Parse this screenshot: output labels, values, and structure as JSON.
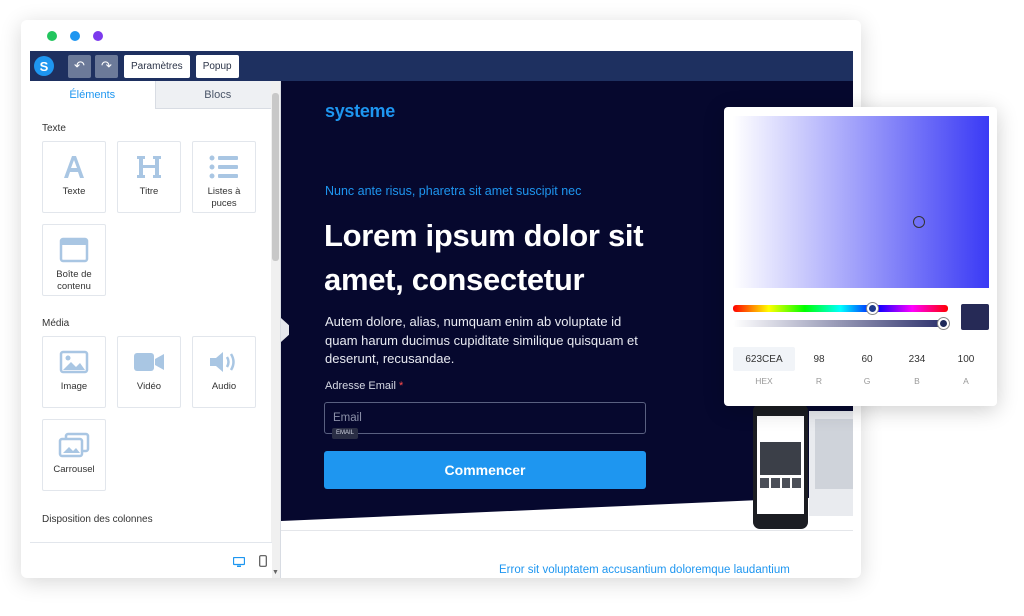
{
  "window": {
    "traffic_lights": [
      "#22c55e",
      "#1e96f0",
      "#7c3aed"
    ]
  },
  "toolbar": {
    "logo_letter": "S",
    "undo_icon": "undo-icon",
    "redo_icon": "redo-icon",
    "settings_label": "Paramètres",
    "popup_label": "Popup"
  },
  "sidebar": {
    "tabs": [
      {
        "label": "Éléments",
        "active": true
      },
      {
        "label": "Blocs",
        "active": false
      }
    ],
    "sections": {
      "texte": "Texte",
      "media": "Média",
      "columns": "Disposition des colonnes"
    },
    "text_items": [
      {
        "label": "Texte",
        "icon": "text-a-icon"
      },
      {
        "label": "Titre",
        "icon": "heading-h-icon"
      },
      {
        "label": "Listes à puces",
        "icon": "bullet-list-icon"
      },
      {
        "label": "Boîte de contenu",
        "icon": "content-box-icon"
      }
    ],
    "media_items": [
      {
        "label": "Image",
        "icon": "image-icon"
      },
      {
        "label": "Vidéo",
        "icon": "video-camera-icon"
      },
      {
        "label": "Audio",
        "icon": "speaker-icon"
      },
      {
        "label": "Carrousel",
        "icon": "carousel-icon"
      }
    ],
    "view_icons": [
      "desktop-icon",
      "mobile-icon"
    ]
  },
  "canvas": {
    "brand": "systeme",
    "eyebrow": "Nunc ante risus, pharetra sit amet suscipit nec",
    "headline": "Lorem ipsum dolor sit amet, consectetur",
    "paragraph": "Autem dolore, alias, numquam enim ab voluptate id quam harum ducimus cupiditate similique quisquam et deserunt, recusandae.",
    "email_label": "Adresse Email",
    "required_mark": "*",
    "email_placeholder": "Email",
    "email_tag": "EMAIL",
    "cta_label": "Commencer",
    "footer_text": "Error sit voluptatem accusantium doloremque laudantium",
    "hero_color": "#06082e",
    "accent_color": "#1e96f0"
  },
  "color_picker": {
    "hex": "623CEA",
    "r": "98",
    "g": "60",
    "b": "234",
    "a": "100",
    "labels": {
      "hex": "HEX",
      "r": "R",
      "g": "G",
      "b": "B",
      "a": "A"
    },
    "swatch_color": "#262a56"
  }
}
